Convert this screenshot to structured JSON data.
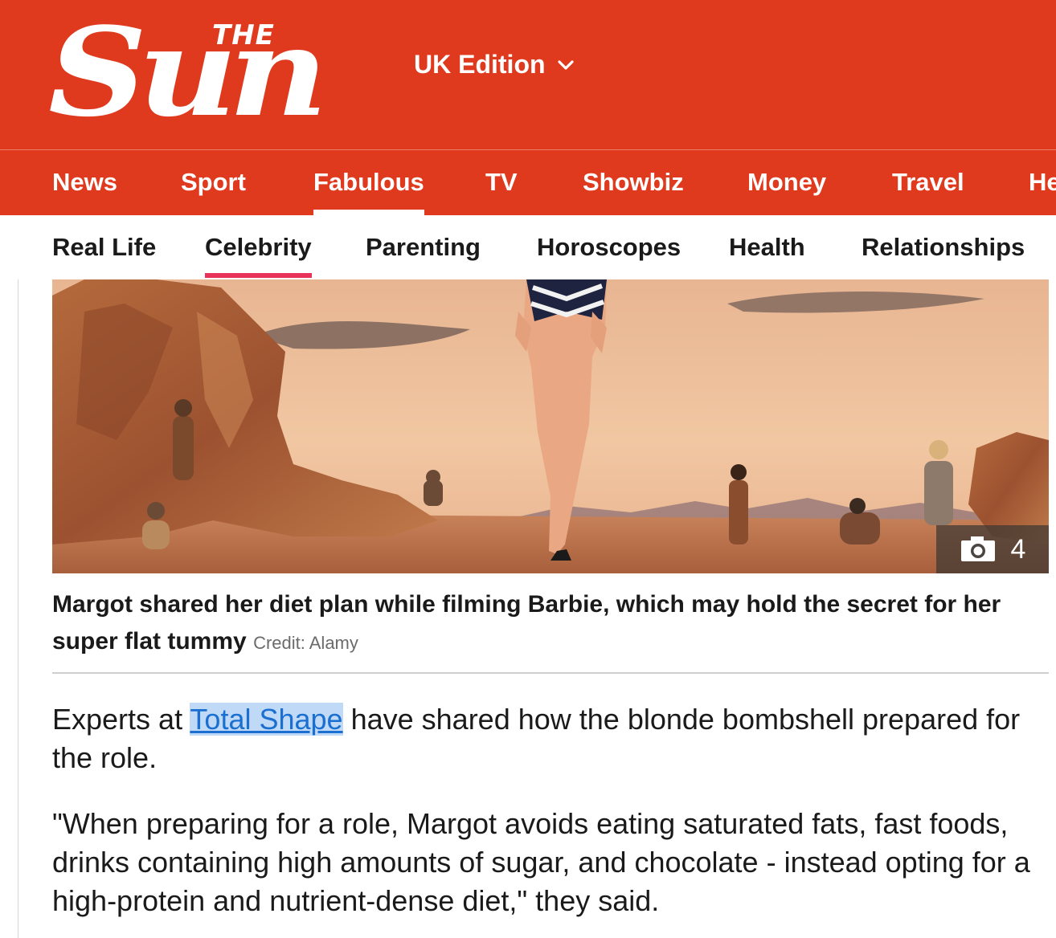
{
  "masthead": {
    "logo_the": "THE",
    "logo_sun": "Sun",
    "edition_label": "UK Edition",
    "edition_icon": "chevron-down-icon"
  },
  "primary_nav": {
    "items": [
      {
        "label": "News"
      },
      {
        "label": "Sport"
      },
      {
        "label": "Fabulous",
        "active": true
      },
      {
        "label": "TV"
      },
      {
        "label": "Showbiz"
      },
      {
        "label": "Money"
      },
      {
        "label": "Travel"
      },
      {
        "label": "He"
      }
    ]
  },
  "secondary_nav": {
    "items": [
      {
        "label": "Real Life"
      },
      {
        "label": "Celebrity",
        "active": true
      },
      {
        "label": "Parenting"
      },
      {
        "label": "Horoscopes"
      },
      {
        "label": "Health"
      },
      {
        "label": "Relationships"
      }
    ]
  },
  "hero": {
    "gallery_icon": "camera-icon",
    "gallery_count": "4"
  },
  "caption": {
    "text": "Margot shared her diet plan while filming Barbie, which may hold the secret for her super flat tummy",
    "credit": "Credit: Alamy"
  },
  "article": {
    "p1_before": "Experts at ",
    "p1_link": "Total Shape",
    "p1_after": " have shared how the blonde bombshell prepared for the role.",
    "p2": "\"When preparing for a role, Margot avoids eating saturated fats, fast foods, drinks containing high amounts of sugar, and chocolate - instead opting for a high-protein and nutrient-dense diet,\" they said."
  },
  "colors": {
    "brand_red": "#e03a1e",
    "active_underline_secondary": "#e8325a",
    "link": "#1a6fd1",
    "link_highlight": "#bfd9f7"
  }
}
